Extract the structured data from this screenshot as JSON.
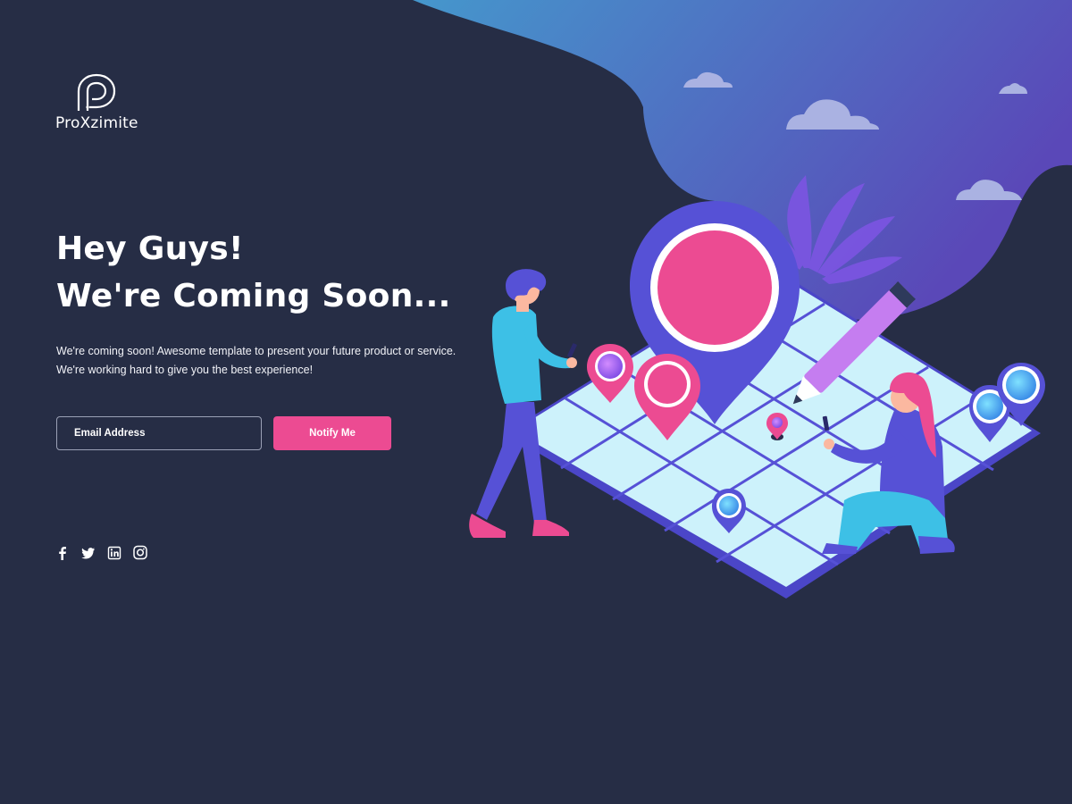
{
  "brand": {
    "name": "ProXzimite",
    "logo_icon": "p-logo-icon"
  },
  "hero": {
    "headline_line1": "Hey Guys!",
    "headline_line2": "We're Coming Soon...",
    "description_line1": "We're coming soon! Awesome template to present your future product or service.",
    "description_line2": "We're working hard to give you the best experience!"
  },
  "form": {
    "email_placeholder": "Email Address",
    "email_value": "",
    "notify_label": "Notify Me"
  },
  "social": [
    {
      "name": "facebook",
      "icon": "facebook-icon"
    },
    {
      "name": "twitter",
      "icon": "twitter-icon"
    },
    {
      "name": "linkedin",
      "icon": "linkedin-icon"
    },
    {
      "name": "instagram",
      "icon": "instagram-icon"
    }
  ],
  "colors": {
    "background": "#262d45",
    "accent_pink": "#ec4b92",
    "purple": "#5651d6",
    "map_tile": "#cdf2fb",
    "blob_start": "#4597cc",
    "blob_end": "#5a48b8"
  }
}
